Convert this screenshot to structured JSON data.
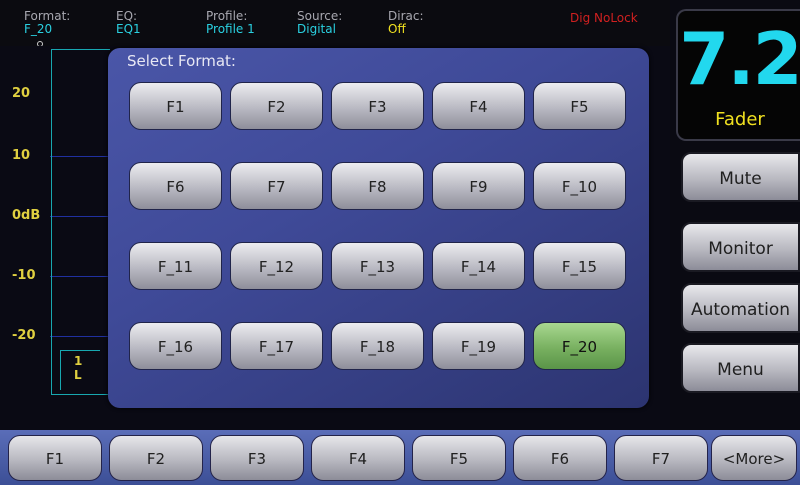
{
  "status": {
    "format": {
      "label": "Format:",
      "value": "F_20"
    },
    "eq": {
      "label": "EQ:",
      "value": "EQ1"
    },
    "profile": {
      "label": "Profile:",
      "value": "Profile 1"
    },
    "source": {
      "label": "Source:",
      "value": "Digital"
    },
    "dirac": {
      "label": "Dirac:",
      "value": "Off"
    },
    "lock": "Dig NoLock"
  },
  "meter": {
    "scale": [
      "20",
      "10",
      "0dB",
      "-10",
      "-20"
    ],
    "channel": {
      "number": "1",
      "name": "L"
    }
  },
  "fader": {
    "value": "7.2",
    "label": "Fader"
  },
  "side_buttons": {
    "mute": "Mute",
    "monitor": "Monitor",
    "automation": "Automation",
    "menu": "Menu"
  },
  "dialog": {
    "title": "Select Format:",
    "formats": [
      "F1",
      "F2",
      "F3",
      "F4",
      "F5",
      "F6",
      "F7",
      "F8",
      "F9",
      "F_10",
      "F_11",
      "F_12",
      "F_13",
      "F_14",
      "F_15",
      "F_16",
      "F_17",
      "F_18",
      "F_19",
      "F_20"
    ],
    "selected": "F_20"
  },
  "function_keys": [
    "F1",
    "F2",
    "F3",
    "F4",
    "F5",
    "F6",
    "F7",
    "<More>"
  ],
  "colors": {
    "accent_cyan": "#2ad0e0",
    "accent_yellow": "#f0e020",
    "alert_red": "#d02020",
    "selected_green": "#7ab462"
  }
}
